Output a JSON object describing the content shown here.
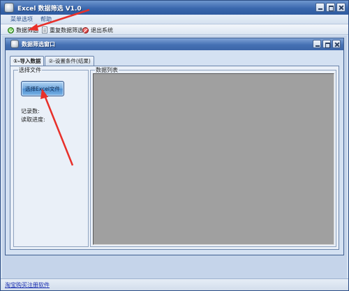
{
  "window": {
    "title": "Excel 数据筛选 V1.0"
  },
  "menubar": {
    "items": [
      "菜单选项",
      "帮助"
    ]
  },
  "toolbar": {
    "items": [
      {
        "label": "数据筛选",
        "icon": "green-check-icon"
      },
      {
        "label": "重复数据筛选",
        "icon": "document-icon"
      },
      {
        "label": "退出系统",
        "icon": "stop-icon"
      }
    ]
  },
  "child_window": {
    "title": "数据筛选窗口",
    "tabs": [
      "①-导入数据",
      "②-设置条件(结果)"
    ],
    "group_file": {
      "label": "选择文件",
      "button": "选择Excel文件",
      "record_count_label": "记录数:",
      "progress_label": "读取进度:"
    },
    "group_data": {
      "label": "数据列表"
    }
  },
  "statusbar": {
    "link": "淘宝购买注册软件"
  },
  "colors": {
    "title_blue": "#3a67ad",
    "arrow_red": "#e8302a",
    "grid_gray": "#a0a0a0"
  }
}
